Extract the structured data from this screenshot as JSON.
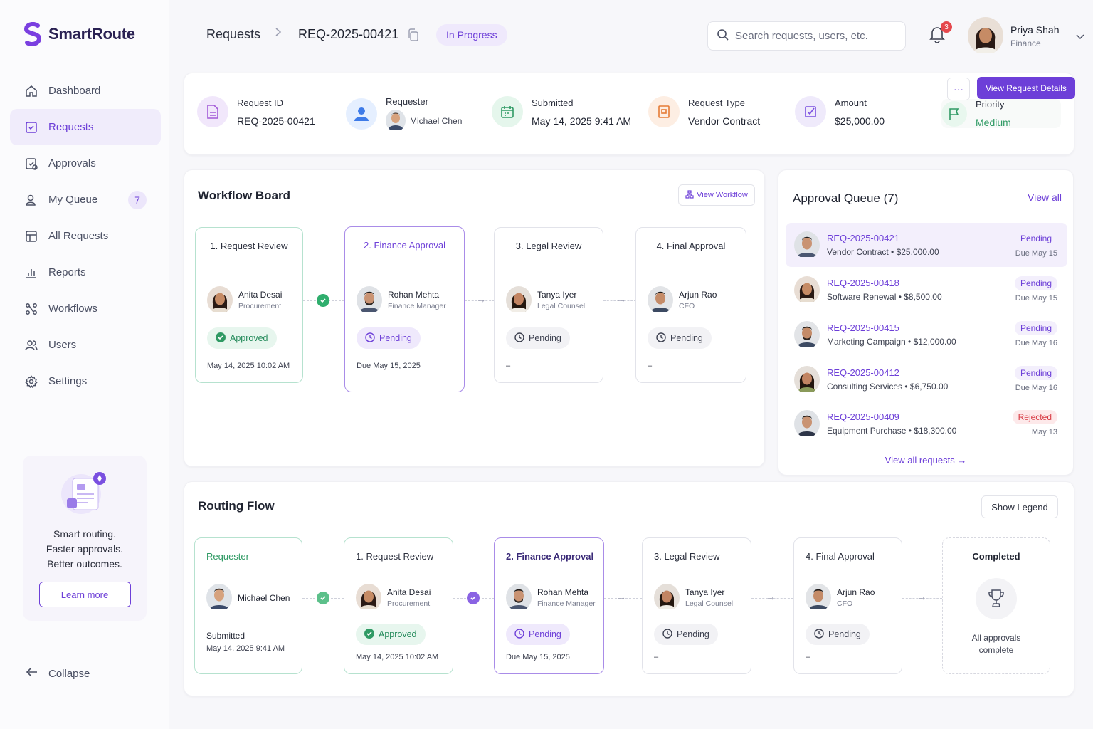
{
  "app": {
    "name": "SmartRoute",
    "brand_color": "#6d3fd8"
  },
  "sidebar": {
    "items": [
      {
        "label": "Dashboard",
        "icon": "home-icon"
      },
      {
        "label": "Requests",
        "icon": "request-icon",
        "active": true
      },
      {
        "label": "Approvals",
        "icon": "approvals-icon"
      },
      {
        "label": "My Queue",
        "icon": "queue-icon",
        "badge": "7"
      },
      {
        "label": "All Requests",
        "icon": "list-icon"
      },
      {
        "label": "Reports",
        "icon": "chart-icon"
      },
      {
        "label": "Workflows",
        "icon": "workflow-icon"
      },
      {
        "label": "Users",
        "icon": "users-icon"
      },
      {
        "label": "Settings",
        "icon": "gear-icon"
      }
    ],
    "promo": {
      "line1": "Smart routing.",
      "line2": "Faster approvals.",
      "line3": "Better outcomes.",
      "button": "Learn more"
    },
    "collapse": "Collapse"
  },
  "header": {
    "breadcrumb_root": "Requests",
    "request_id": "REQ-2025-00421",
    "status": "In Progress",
    "search_placeholder": "Search requests, users, etc.",
    "notifications": "3",
    "user": {
      "name": "Priya Shah",
      "role": "Finance"
    }
  },
  "summary": {
    "request_id": {
      "label": "Request ID",
      "value": "REQ-2025-00421"
    },
    "requester": {
      "label": "Requester",
      "value": "Michael Chen"
    },
    "submitted": {
      "label": "Submitted",
      "value": "May 14, 2025 9:41 AM"
    },
    "request_type": {
      "label": "Request Type",
      "value": "Vendor Contract"
    },
    "amount": {
      "label": "Amount",
      "value": "$25,000.00"
    },
    "priority": {
      "label": "Priority",
      "value": "Medium"
    },
    "more": "···",
    "details_button": "View Request Details"
  },
  "workflow_board": {
    "title": "Workflow Board",
    "view_button": "View Workflow",
    "stages": [
      {
        "title": "1. Request Review",
        "person": "Anita Desai",
        "role": "Procurement",
        "status": "Approved",
        "foot": "May 14, 2025 10:02 AM"
      },
      {
        "title": "2. Finance Approval",
        "person": "Rohan Mehta",
        "role": "Finance Manager",
        "status": "Pending",
        "foot": "Due May 15, 2025"
      },
      {
        "title": "3. Legal Review",
        "person": "Tanya Iyer",
        "role": "Legal Counsel",
        "status": "Pending",
        "foot": "–"
      },
      {
        "title": "4. Final Approval",
        "person": "Arjun Rao",
        "role": "CFO",
        "status": "Pending",
        "foot": "–"
      }
    ]
  },
  "approval_queue": {
    "title": "Approval Queue (7)",
    "view_all": "View all",
    "rows": [
      {
        "id": "REQ-2025-00421",
        "desc": "Vendor Contract • $25,000.00",
        "status": "Pending",
        "due": "Due May 15"
      },
      {
        "id": "REQ-2025-00418",
        "desc": "Software Renewal • $8,500.00",
        "status": "Pending",
        "due": "Due May 15"
      },
      {
        "id": "REQ-2025-00415",
        "desc": "Marketing Campaign • $12,000.00",
        "status": "Pending",
        "due": "Due May 16"
      },
      {
        "id": "REQ-2025-00412",
        "desc": "Consulting Services • $6,750.00",
        "status": "Pending",
        "due": "Due May 16"
      },
      {
        "id": "REQ-2025-00409",
        "desc": "Equipment Purchase • $18,300.00",
        "status": "Rejected",
        "due": "May 13"
      }
    ],
    "footer": "View all requests →"
  },
  "routing_flow": {
    "title": "Routing Flow",
    "legend_button": "Show Legend",
    "requester": {
      "title": "Requester",
      "person": "Michael Chen",
      "foot_label": "Submitted",
      "foot": "May 14, 2025 9:41 AM"
    },
    "stages": [
      {
        "title": "1. Request Review",
        "person": "Anita Desai",
        "role": "Procurement",
        "status": "Approved",
        "foot": "May 14, 2025 10:02 AM"
      },
      {
        "title": "2. Finance Approval",
        "person": "Rohan Mehta",
        "role": "Finance Manager",
        "status": "Pending",
        "foot": "Due May 15, 2025"
      },
      {
        "title": "3. Legal Review",
        "person": "Tanya Iyer",
        "role": "Legal Counsel",
        "status": "Pending",
        "foot": "–"
      },
      {
        "title": "4. Final Approval",
        "person": "Arjun Rao",
        "role": "CFO",
        "status": "Pending",
        "foot": "–"
      }
    ],
    "completed": {
      "title": "Completed",
      "line1": "All approvals",
      "line2": "complete"
    }
  }
}
